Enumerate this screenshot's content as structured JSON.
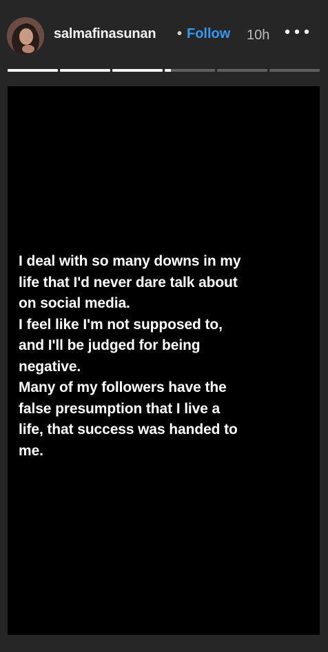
{
  "header": {
    "username": "salmafinasunan",
    "separator": "•",
    "follow_label": "Follow",
    "timestamp": "10h",
    "more_icon": "more-horizontal-icon",
    "avatar": "profile-photo"
  },
  "progress": {
    "segments": [
      1.0,
      1.0,
      1.0,
      0.12,
      0,
      0
    ],
    "filled_color": "#f5f5f5",
    "empty_color": "#5f5f5f"
  },
  "story": {
    "background": "#000000",
    "paragraphs": [
      "I deal with so many downs in my\nlife that I'd never dare talk about\non social media.",
      "I feel like I'm not supposed to,\nand I'll be judged for being\nnegative.",
      "Many of my followers have the\nfalse presumption that I live a\nlife, that success was handed to\nme."
    ]
  },
  "colors": {
    "page_background": "#262626",
    "follow_accent": "#3a97f0",
    "text": "#ffffff"
  }
}
